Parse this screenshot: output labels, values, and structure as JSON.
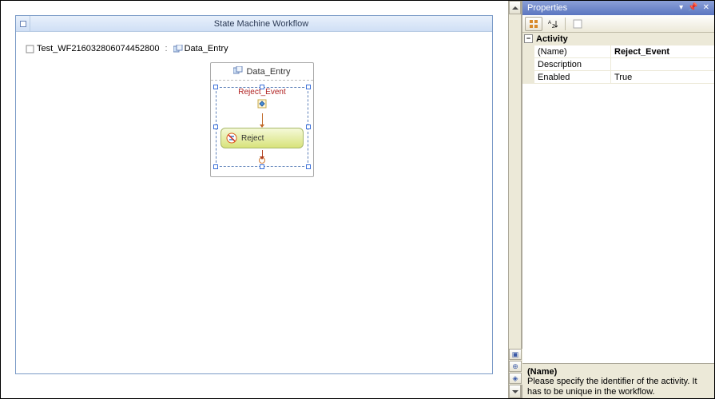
{
  "workflow": {
    "title": "State Machine Workflow",
    "breadcrumb": [
      {
        "label": "Test_WF216032806074452800"
      },
      {
        "label": "Data_Entry"
      }
    ],
    "state_node": {
      "name": "Data_Entry",
      "event": {
        "name": "Reject_Event"
      },
      "activity_chip": {
        "label": "Reject"
      }
    }
  },
  "properties": {
    "panel_title": "Properties",
    "category": "Activity",
    "rows": [
      {
        "name": "(Name)",
        "value": "Reject_Event",
        "bold": true
      },
      {
        "name": "Description",
        "value": ""
      },
      {
        "name": "Enabled",
        "value": "True"
      }
    ],
    "description": {
      "title": "(Name)",
      "body": "Please specify the identifier of the activity. It has to be unique in the workflow."
    }
  }
}
